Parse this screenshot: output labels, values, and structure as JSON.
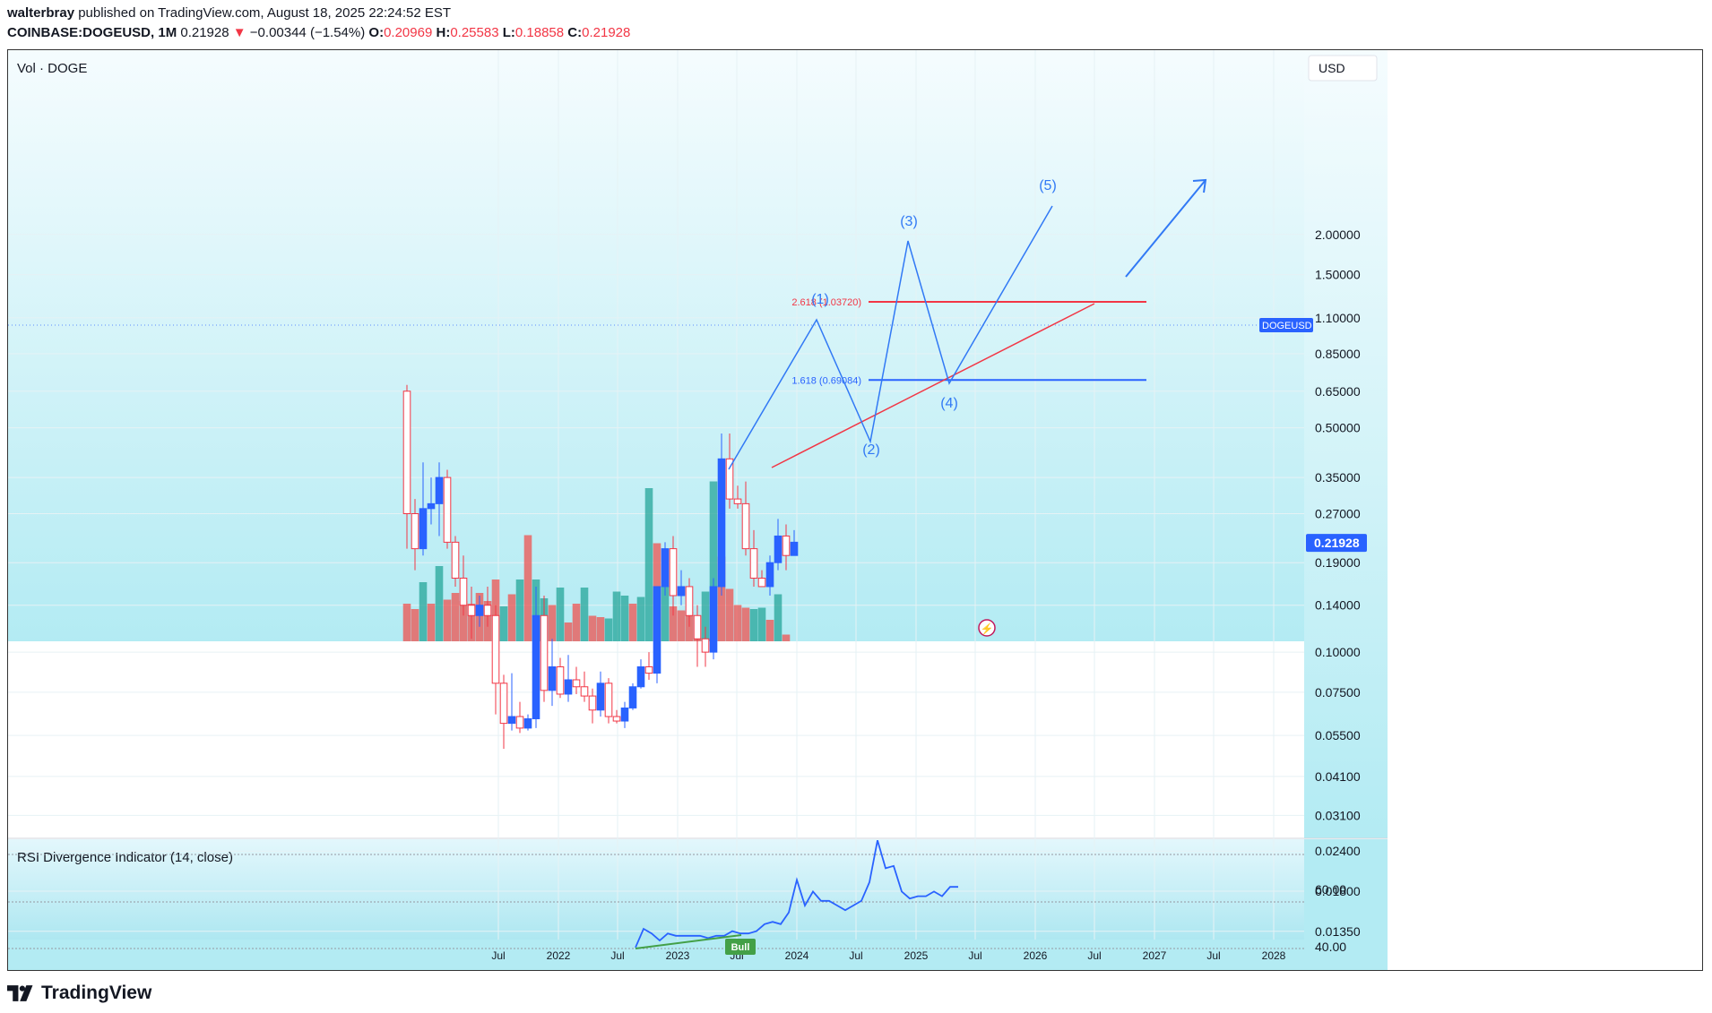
{
  "header": {
    "author": "walterbray",
    "published": " published on TradingView.com, August 18, 2025 22:24:52 EST",
    "symbol": "COINBASE:DOGEUSD, 1M",
    "last": "0.21928",
    "change_arrow": "▼",
    "change": "−0.00344 (−1.54%)",
    "o_label": "O:",
    "o": "0.20969",
    "h_label": "H:",
    "h": "0.25583",
    "l_label": "L:",
    "l": "0.18858",
    "c_label": "C:",
    "c": "0.21928"
  },
  "colors": {
    "up": "#2962ff",
    "down": "#f23645",
    "vol_up": "#26a69a",
    "vol_down": "#ef5350",
    "panel_top": "#f4fbfe",
    "panel_bottom": "#b2ebf2",
    "trend": "#f23645",
    "wave": "#3179f5",
    "rsi": "#2962ff",
    "bull": "#43a047"
  },
  "chart_data": {
    "type": "candlestick",
    "timeframe": "1M",
    "price_axis_currency": "USD",
    "volume_label": "Vol · DOGE",
    "y_scale": "log",
    "y_ticks": [
      "2.00000",
      "1.50000",
      "1.10000",
      "0.85000",
      "0.65000",
      "0.50000",
      "0.35000",
      "0.27000",
      "0.19000",
      "0.14000",
      "0.10000",
      "0.07500",
      "0.05500",
      "0.04100",
      "0.03100",
      "0.02400",
      "0.01800",
      "0.01350"
    ],
    "x_ticks": [
      "Jul",
      "2022",
      "Jul",
      "2023",
      "Jul",
      "2024",
      "Jul",
      "2025",
      "Jul",
      "2026",
      "Jul",
      "2027",
      "Jul",
      "2028"
    ],
    "current_price_label": "0.21928",
    "symbol_tag": "DOGEUSD",
    "candles": [
      {
        "o": 0.65,
        "h": 0.68,
        "l": 0.21,
        "c": 0.27
      },
      {
        "o": 0.27,
        "h": 0.3,
        "l": 0.18,
        "c": 0.21
      },
      {
        "o": 0.21,
        "h": 0.39,
        "l": 0.2,
        "c": 0.28
      },
      {
        "o": 0.28,
        "h": 0.35,
        "l": 0.25,
        "c": 0.29
      },
      {
        "o": 0.29,
        "h": 0.39,
        "l": 0.23,
        "c": 0.35
      },
      {
        "o": 0.35,
        "h": 0.37,
        "l": 0.21,
        "c": 0.22
      },
      {
        "o": 0.22,
        "h": 0.23,
        "l": 0.16,
        "c": 0.17
      },
      {
        "o": 0.17,
        "h": 0.2,
        "l": 0.13,
        "c": 0.14
      },
      {
        "o": 0.14,
        "h": 0.16,
        "l": 0.11,
        "c": 0.13
      },
      {
        "o": 0.13,
        "h": 0.15,
        "l": 0.12,
        "c": 0.14
      },
      {
        "o": 0.14,
        "h": 0.16,
        "l": 0.12,
        "c": 0.13
      },
      {
        "o": 0.13,
        "h": 0.14,
        "l": 0.064,
        "c": 0.08
      },
      {
        "o": 0.08,
        "h": 0.085,
        "l": 0.05,
        "c": 0.06
      },
      {
        "o": 0.06,
        "h": 0.086,
        "l": 0.057,
        "c": 0.063
      },
      {
        "o": 0.063,
        "h": 0.07,
        "l": 0.056,
        "c": 0.058
      },
      {
        "o": 0.058,
        "h": 0.064,
        "l": 0.057,
        "c": 0.062
      },
      {
        "o": 0.062,
        "h": 0.16,
        "l": 0.058,
        "c": 0.13
      },
      {
        "o": 0.13,
        "h": 0.15,
        "l": 0.07,
        "c": 0.076
      },
      {
        "o": 0.076,
        "h": 0.11,
        "l": 0.068,
        "c": 0.09
      },
      {
        "o": 0.09,
        "h": 0.096,
        "l": 0.072,
        "c": 0.074
      },
      {
        "o": 0.074,
        "h": 0.098,
        "l": 0.07,
        "c": 0.082
      },
      {
        "o": 0.082,
        "h": 0.09,
        "l": 0.074,
        "c": 0.078
      },
      {
        "o": 0.078,
        "h": 0.087,
        "l": 0.07,
        "c": 0.073
      },
      {
        "o": 0.073,
        "h": 0.077,
        "l": 0.06,
        "c": 0.066
      },
      {
        "o": 0.066,
        "h": 0.087,
        "l": 0.063,
        "c": 0.08
      },
      {
        "o": 0.08,
        "h": 0.083,
        "l": 0.06,
        "c": 0.063
      },
      {
        "o": 0.063,
        "h": 0.066,
        "l": 0.06,
        "c": 0.061
      },
      {
        "o": 0.061,
        "h": 0.07,
        "l": 0.058,
        "c": 0.067
      },
      {
        "o": 0.067,
        "h": 0.08,
        "l": 0.066,
        "c": 0.078
      },
      {
        "o": 0.078,
        "h": 0.095,
        "l": 0.077,
        "c": 0.09
      },
      {
        "o": 0.09,
        "h": 0.1,
        "l": 0.082,
        "c": 0.086
      },
      {
        "o": 0.086,
        "h": 0.12,
        "l": 0.08,
        "c": 0.16
      },
      {
        "o": 0.16,
        "h": 0.22,
        "l": 0.15,
        "c": 0.21
      },
      {
        "o": 0.21,
        "h": 0.23,
        "l": 0.13,
        "c": 0.15
      },
      {
        "o": 0.15,
        "h": 0.18,
        "l": 0.14,
        "c": 0.16
      },
      {
        "o": 0.16,
        "h": 0.17,
        "l": 0.12,
        "c": 0.13
      },
      {
        "o": 0.13,
        "h": 0.14,
        "l": 0.09,
        "c": 0.11
      },
      {
        "o": 0.11,
        "h": 0.12,
        "l": 0.09,
        "c": 0.1
      },
      {
        "o": 0.1,
        "h": 0.17,
        "l": 0.095,
        "c": 0.16
      },
      {
        "o": 0.16,
        "h": 0.48,
        "l": 0.15,
        "c": 0.4
      },
      {
        "o": 0.4,
        "h": 0.48,
        "l": 0.28,
        "c": 0.3
      },
      {
        "o": 0.3,
        "h": 0.33,
        "l": 0.28,
        "c": 0.29
      },
      {
        "o": 0.29,
        "h": 0.34,
        "l": 0.2,
        "c": 0.21
      },
      {
        "o": 0.21,
        "h": 0.24,
        "l": 0.16,
        "c": 0.17
      },
      {
        "o": 0.17,
        "h": 0.18,
        "l": 0.16,
        "c": 0.16
      },
      {
        "o": 0.16,
        "h": 0.2,
        "l": 0.15,
        "c": 0.19
      },
      {
        "o": 0.19,
        "h": 0.26,
        "l": 0.18,
        "c": 0.23
      },
      {
        "o": 0.23,
        "h": 0.25,
        "l": 0.18,
        "c": 0.2
      },
      {
        "o": 0.2,
        "h": 0.24,
        "l": 0.2,
        "c": 0.22
      }
    ],
    "volume": [
      {
        "v": 0.28,
        "d": "down"
      },
      {
        "v": 0.24,
        "d": "down"
      },
      {
        "v": 0.44,
        "d": "up"
      },
      {
        "v": 0.28,
        "d": "down"
      },
      {
        "v": 0.56,
        "d": "up"
      },
      {
        "v": 0.31,
        "d": "down"
      },
      {
        "v": 0.36,
        "d": "down"
      },
      {
        "v": 0.3,
        "d": "down"
      },
      {
        "v": 0.28,
        "d": "down"
      },
      {
        "v": 0.36,
        "d": "down"
      },
      {
        "v": 0.3,
        "d": "down"
      },
      {
        "v": 0.46,
        "d": "down"
      },
      {
        "v": 0.26,
        "d": "up"
      },
      {
        "v": 0.35,
        "d": "down"
      },
      {
        "v": 0.46,
        "d": "up"
      },
      {
        "v": 0.79,
        "d": "down"
      },
      {
        "v": 0.46,
        "d": "up"
      },
      {
        "v": 0.32,
        "d": "up"
      },
      {
        "v": 0.27,
        "d": "down"
      },
      {
        "v": 0.4,
        "d": "up"
      },
      {
        "v": 0.14,
        "d": "down"
      },
      {
        "v": 0.28,
        "d": "down"
      },
      {
        "v": 0.4,
        "d": "up"
      },
      {
        "v": 0.19,
        "d": "down"
      },
      {
        "v": 0.18,
        "d": "down"
      },
      {
        "v": 0.17,
        "d": "up"
      },
      {
        "v": 0.37,
        "d": "up"
      },
      {
        "v": 0.34,
        "d": "up"
      },
      {
        "v": 0.28,
        "d": "down"
      },
      {
        "v": 0.33,
        "d": "up"
      },
      {
        "v": 1.14,
        "d": "up"
      },
      {
        "v": 0.73,
        "d": "down"
      },
      {
        "v": 0.41,
        "d": "up"
      },
      {
        "v": 0.26,
        "d": "down"
      },
      {
        "v": 0.23,
        "d": "down"
      },
      {
        "v": 0.22,
        "d": "down"
      },
      {
        "v": 0.19,
        "d": "down"
      },
      {
        "v": 0.37,
        "d": "up"
      },
      {
        "v": 1.19,
        "d": "up"
      },
      {
        "v": 0.63,
        "d": "down"
      },
      {
        "v": 0.39,
        "d": "down"
      },
      {
        "v": 0.27,
        "d": "down"
      },
      {
        "v": 0.25,
        "d": "down"
      },
      {
        "v": 0.24,
        "d": "up"
      },
      {
        "v": 0.25,
        "d": "up"
      },
      {
        "v": 0.16,
        "d": "down"
      },
      {
        "v": 0.35,
        "d": "up"
      },
      {
        "v": 0.05,
        "d": "down"
      }
    ],
    "fib_levels": [
      {
        "label": "2.618 (1.03720)",
        "value": 1.0372,
        "color": "#f23645"
      },
      {
        "label": "1.618 (0.69084)",
        "value": 0.69084,
        "color": "#2962ff"
      }
    ],
    "waves": [
      {
        "label": "(1)"
      },
      {
        "label": "(2)"
      },
      {
        "label": "(3)"
      },
      {
        "label": "(4)"
      },
      {
        "label": "(5)"
      }
    ],
    "rsi": {
      "title": "RSI Divergence Indicator (14, close)",
      "y_ticks": [
        "60.00",
        "40.00"
      ],
      "bull_label": "Bull",
      "values": [
        42,
        50,
        48,
        45,
        48,
        47,
        47,
        47,
        47,
        46,
        47,
        47,
        49,
        48,
        48,
        49,
        52,
        53,
        52,
        57,
        71,
        60,
        66,
        62,
        62,
        60,
        58,
        60,
        62,
        70,
        88,
        76,
        77,
        66,
        63,
        64,
        64,
        66,
        64,
        68,
        68
      ]
    }
  }
}
